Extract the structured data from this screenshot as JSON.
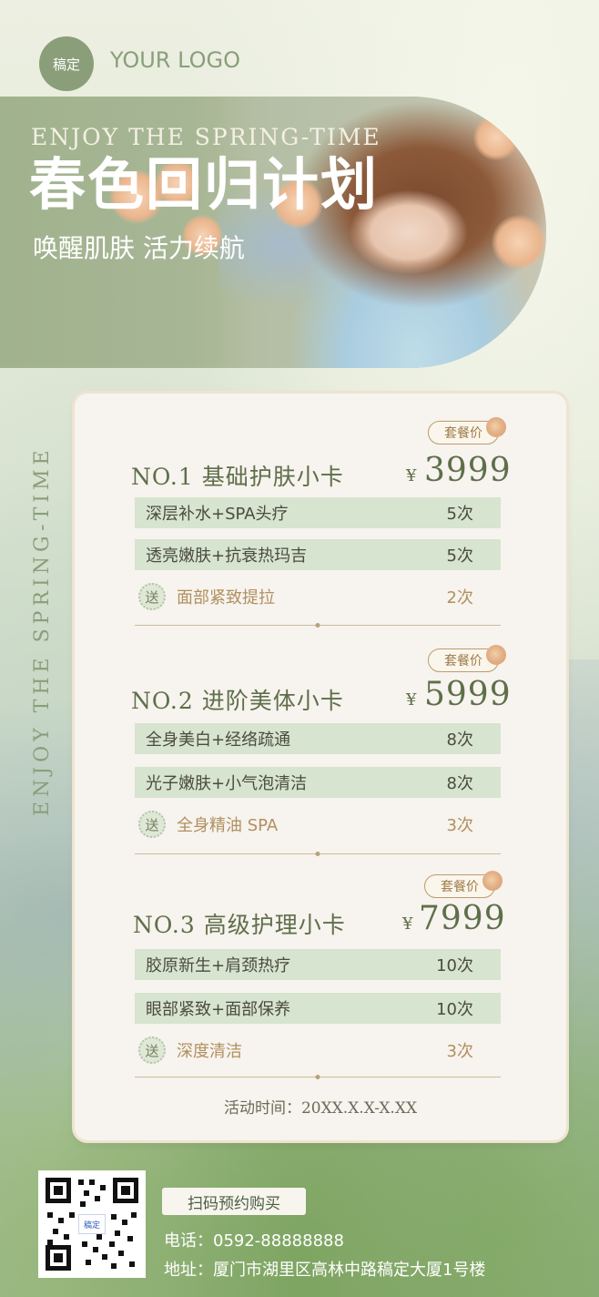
{
  "logo": {
    "badge": "稿定",
    "text": "YOUR LOGO"
  },
  "hero": {
    "english": "ENJOY THE SPRING-TIME",
    "title": "春色回归计划",
    "subtitle": "唤醒肌肤 活力续航"
  },
  "side_text": "ENJOY THE SPRING-TIME",
  "packages": [
    {
      "badge": "套餐价",
      "name": "NO.1 基础护肤小卡",
      "currency": "¥",
      "price": "3999",
      "items": [
        {
          "label": "深层补水+SPA头疗",
          "count": "5次"
        },
        {
          "label": "透亮嫩肤+抗衰热玛吉",
          "count": "5次"
        }
      ],
      "gift": {
        "icon": "送",
        "label": "面部紧致提拉",
        "count": "2次"
      }
    },
    {
      "badge": "套餐价",
      "name": "NO.2 进阶美体小卡",
      "currency": "¥",
      "price": "5999",
      "items": [
        {
          "label": "全身美白+经络疏通",
          "count": "8次"
        },
        {
          "label": "光子嫩肤+小气泡清洁",
          "count": "8次"
        }
      ],
      "gift": {
        "icon": "送",
        "label": "全身精油 SPA",
        "count": "3次"
      }
    },
    {
      "badge": "套餐价",
      "name": "NO.3 高级护理小卡",
      "currency": "¥",
      "price": "7999",
      "items": [
        {
          "label": "胶原新生+肩颈热疗",
          "count": "10次"
        },
        {
          "label": "眼部紧致+面部保养",
          "count": "10次"
        }
      ],
      "gift": {
        "icon": "送",
        "label": "深度清洁",
        "count": "3次"
      }
    }
  ],
  "activity_time": "活动时间：20XX.X.X-X.XX",
  "footer": {
    "qr_center": "稿定",
    "scan_label": "扫码预约购买",
    "phone": "电话：0592-88888888",
    "address": "地址：厦门市湖里区高林中路稿定大厦1号楼"
  },
  "colors": {
    "accent_green": "#8a9e7a",
    "text_green": "#5e6f4a",
    "row_bg": "#d7e4d0",
    "gold": "#b09060"
  }
}
